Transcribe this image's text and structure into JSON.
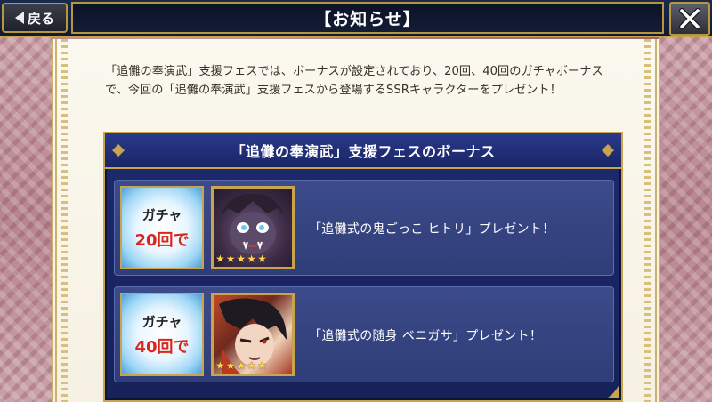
{
  "header": {
    "back_label": "戻る",
    "title": "【お知らせ】"
  },
  "notice": {
    "intro": "「追儺の奉演武」支援フェスでは、ボーナスが設定されており、20回、40回のガチャボーナスで、今回の「追儺の奉演武」支援フェスから登場するSSRキャラクターをプレゼント！"
  },
  "bonus": {
    "heading": "「追儺の奉演武」支援フェスのボーナス",
    "rows": [
      {
        "badge_top": "ガチャ",
        "badge_count": "20回で",
        "stars": "★★★★★",
        "text": "「追儺式の鬼ごっこ ヒトリ」プレゼント！"
      },
      {
        "badge_top": "ガチャ",
        "badge_count": "40回で",
        "stars": "★★★★★",
        "text": "「追儺式の随身 ベニガサ」プレゼント！"
      }
    ]
  },
  "colors": {
    "accent_gold": "#c8a44c",
    "panel_blue": "#1d2a6b",
    "count_red": "#d9261c"
  }
}
